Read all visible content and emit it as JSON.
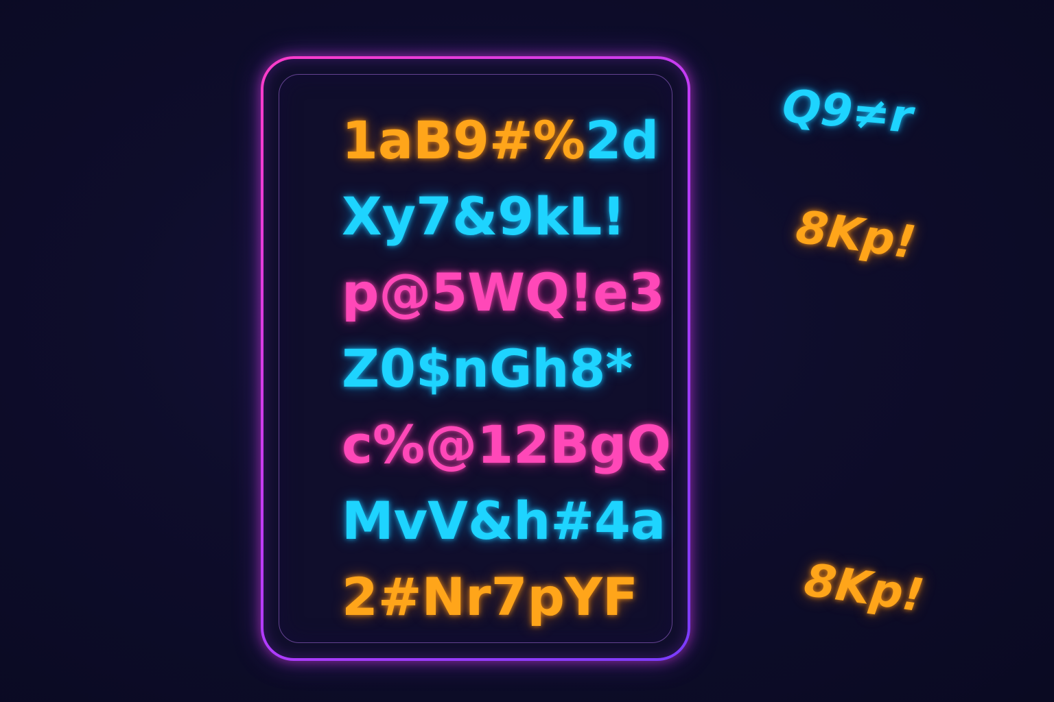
{
  "panel": {
    "lines": [
      {
        "text_a": "1aB9#%",
        "text_b": "2d"
      },
      {
        "text": "Xy7&9kL!"
      },
      {
        "text": "p@5WQ!e3"
      },
      {
        "text": "Z0$nGh8*"
      },
      {
        "text": "c%@12BgQ"
      },
      {
        "text": "MvV&h#4a"
      },
      {
        "text": "2#Nr7pYF"
      }
    ]
  },
  "floating": [
    {
      "text": "Q9≠r"
    },
    {
      "text": "8Kp!"
    },
    {
      "text": "8Kp!"
    }
  ],
  "colors": {
    "background": "#0e0d2b",
    "frame_pink": "#ff3cc8",
    "frame_purple": "#7a3cff",
    "orange": "#ffa51a",
    "cyan": "#1ed4ff",
    "pink": "#ff48b8"
  }
}
